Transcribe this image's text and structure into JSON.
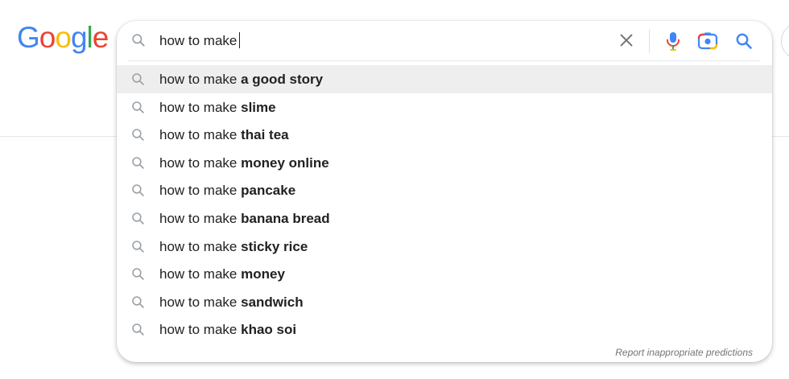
{
  "logo": {
    "letters": [
      "G",
      "o",
      "o",
      "g",
      "l",
      "e"
    ],
    "colors": [
      "#4285F4",
      "#EA4335",
      "#FBBC05",
      "#4285F4",
      "#34A853",
      "#EA4335"
    ]
  },
  "search": {
    "query": "how to make",
    "icons": {
      "leading": "search-icon",
      "clear": "close-icon",
      "voice": "microphone-icon",
      "image": "camera-lens-icon",
      "submit": "search-icon"
    }
  },
  "suggestions": [
    {
      "prefix": "how to make ",
      "completion": "a good story",
      "highlighted": true
    },
    {
      "prefix": "how to make ",
      "completion": "slime",
      "highlighted": false
    },
    {
      "prefix": "how to make ",
      "completion": "thai tea",
      "highlighted": false
    },
    {
      "prefix": "how to make ",
      "completion": "money online",
      "highlighted": false
    },
    {
      "prefix": "how to make ",
      "completion": "pancake",
      "highlighted": false
    },
    {
      "prefix": "how to make ",
      "completion": "banana bread",
      "highlighted": false
    },
    {
      "prefix": "how to make ",
      "completion": "sticky rice",
      "highlighted": false
    },
    {
      "prefix": "how to make ",
      "completion": "money",
      "highlighted": false
    },
    {
      "prefix": "how to make ",
      "completion": "sandwich",
      "highlighted": false
    },
    {
      "prefix": "how to make ",
      "completion": "khao soi",
      "highlighted": false
    }
  ],
  "report_link": "Report inappropriate predictions",
  "colors": {
    "text": "#202124",
    "icon_gray": "#9aa0a6",
    "highlight_bg": "#eeeeee",
    "google_blue": "#4285F4"
  }
}
